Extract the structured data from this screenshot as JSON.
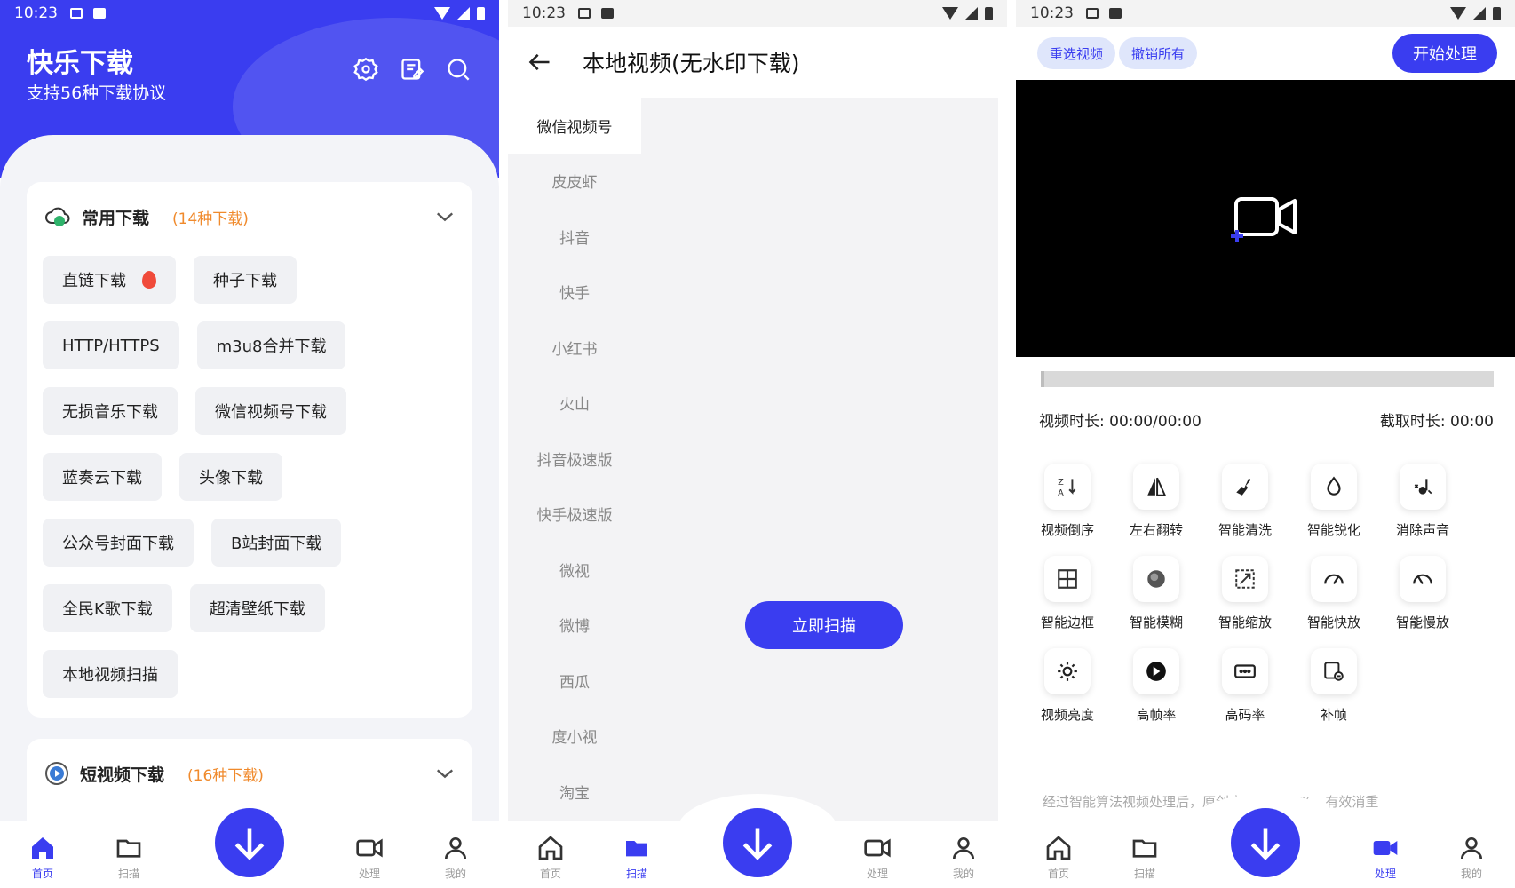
{
  "status": {
    "time": "10:23"
  },
  "home": {
    "app_title": "快乐下载",
    "app_subtitle": "支持56种下载协议",
    "header_icons": [
      "settings-icon",
      "notes-icon",
      "search-icon"
    ],
    "sections": [
      {
        "title": "常用下载",
        "count": "(14种下载)",
        "chips": [
          [
            "直链下载",
            "种子下载"
          ],
          [
            "HTTP/HTTPS",
            "m3u8合并下载"
          ],
          [
            "无损音乐下载",
            "微信视频号下载"
          ],
          [
            "蓝奏云下载",
            "头像下载"
          ],
          [
            "公众号封面下载",
            "B站封面下载"
          ],
          [
            "全民K歌下载",
            "超清壁纸下载"
          ],
          [
            "本地视频扫描"
          ]
        ]
      },
      {
        "title": "短视频下载",
        "count": "(16种下载)"
      }
    ]
  },
  "nav": {
    "items": [
      "首页",
      "扫描",
      "处理",
      "我的"
    ]
  },
  "scan": {
    "title": "本地视频(无水印下载)",
    "platforms": [
      "微信视频号",
      "皮皮虾",
      "抖音",
      "快手",
      "小红书",
      "火山",
      "抖音极速版",
      "快手极速版",
      "微视",
      "微博",
      "西瓜",
      "度小视",
      "淘宝"
    ],
    "scan_button": "立即扫描"
  },
  "process": {
    "reselect": "重选视频",
    "undo_all": "撤销所有",
    "start": "开始处理",
    "video_duration": "视频时长: 00:00/00:00",
    "clip_duration": "截取时长: 00:00",
    "tools": [
      {
        "label": "视频倒序",
        "icon": "sort-reverse-icon"
      },
      {
        "label": "左右翻转",
        "icon": "flip-icon"
      },
      {
        "label": "智能清洗",
        "icon": "broom-icon"
      },
      {
        "label": "智能锐化",
        "icon": "drop-icon"
      },
      {
        "label": "消除声音",
        "icon": "mute-icon"
      },
      {
        "label": "智能边框",
        "icon": "border-icon"
      },
      {
        "label": "智能模糊",
        "icon": "blur-icon"
      },
      {
        "label": "智能缩放",
        "icon": "scale-icon"
      },
      {
        "label": "智能快放",
        "icon": "fast-icon"
      },
      {
        "label": "智能慢放",
        "icon": "slow-icon"
      },
      {
        "label": "视频亮度",
        "icon": "brightness-icon"
      },
      {
        "label": "高帧率",
        "icon": "fps-icon"
      },
      {
        "label": "高码率",
        "icon": "bitrate-icon"
      },
      {
        "label": "补帧",
        "icon": "frame-fill-icon"
      }
    ],
    "hint": "经过智能算法视频处理后，原创度可达到90%，有效消重"
  },
  "colors": {
    "accent": "#3a3df0",
    "count": "#f08a2c"
  }
}
